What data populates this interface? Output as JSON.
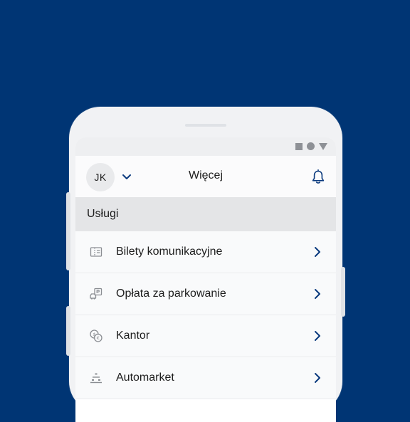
{
  "colors": {
    "background": "#003574",
    "accent": "#0b3a7e",
    "icon_gray": "#8a8d92"
  },
  "status_bar": {
    "icons": [
      "square-icon",
      "circle-icon",
      "triangle-icon"
    ]
  },
  "header": {
    "avatar_initials": "JK",
    "title": "Więcej",
    "account_toggle_icon": "chevron-down-icon",
    "notifications_icon": "bell-icon"
  },
  "section": {
    "title": "Usługi"
  },
  "menu": {
    "items": [
      {
        "label": "Bilety komunikacyjne",
        "icon": "ticket-icon"
      },
      {
        "label": "Opłata za parkowanie",
        "icon": "parking-icon"
      },
      {
        "label": "Kantor",
        "icon": "currency-exchange-icon"
      },
      {
        "label": "Automarket",
        "icon": "automarket-icon"
      }
    ]
  }
}
